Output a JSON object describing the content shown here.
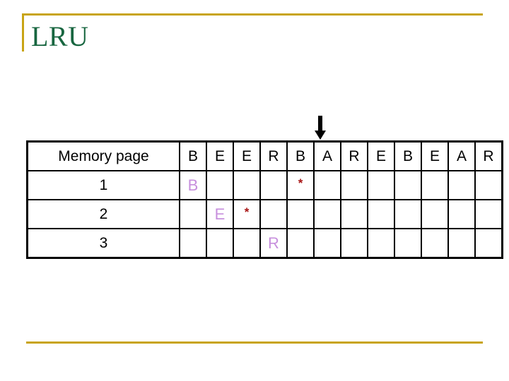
{
  "slide": {
    "title": "LRU",
    "accent_color": "#C8A415",
    "title_color": "#186640"
  },
  "pointer": {
    "icon": "down-arrow-icon",
    "points_at_column_index": 5,
    "points_at_label": "A"
  },
  "table": {
    "header": {
      "label": "Memory page",
      "sequence": [
        "B",
        "E",
        "E",
        "R",
        "B",
        "A",
        "R",
        "E",
        "B",
        "E",
        "A",
        "R"
      ]
    },
    "rows": [
      {
        "label": "1",
        "cells": [
          {
            "text": "B",
            "style": "page",
            "highlight": false
          },
          {
            "text": "",
            "style": "empty",
            "highlight": false
          },
          {
            "text": "",
            "style": "empty",
            "highlight": false
          },
          {
            "text": "",
            "style": "empty",
            "highlight": false
          },
          {
            "text": "*",
            "style": "star",
            "highlight": true
          },
          {
            "text": "",
            "style": "empty",
            "highlight": false
          },
          {
            "text": "",
            "style": "empty",
            "highlight": false
          },
          {
            "text": "",
            "style": "empty",
            "highlight": false
          },
          {
            "text": "",
            "style": "empty",
            "highlight": false
          },
          {
            "text": "",
            "style": "empty",
            "highlight": false
          },
          {
            "text": "",
            "style": "empty",
            "highlight": false
          },
          {
            "text": "",
            "style": "empty",
            "highlight": false
          }
        ]
      },
      {
        "label": "2",
        "cells": [
          {
            "text": "",
            "style": "empty",
            "highlight": false
          },
          {
            "text": "E",
            "style": "page",
            "highlight": false
          },
          {
            "text": "*",
            "style": "star",
            "highlight": true
          },
          {
            "text": "",
            "style": "empty",
            "highlight": true
          },
          {
            "text": "",
            "style": "empty",
            "highlight": true
          },
          {
            "text": "",
            "style": "empty",
            "highlight": false
          },
          {
            "text": "",
            "style": "empty",
            "highlight": false
          },
          {
            "text": "",
            "style": "empty",
            "highlight": false
          },
          {
            "text": "",
            "style": "empty",
            "highlight": false
          },
          {
            "text": "",
            "style": "empty",
            "highlight": false
          },
          {
            "text": "",
            "style": "empty",
            "highlight": false
          },
          {
            "text": "",
            "style": "empty",
            "highlight": false
          }
        ]
      },
      {
        "label": "3",
        "cells": [
          {
            "text": "",
            "style": "empty",
            "highlight": false
          },
          {
            "text": "",
            "style": "empty",
            "highlight": false
          },
          {
            "text": "",
            "style": "empty",
            "highlight": false
          },
          {
            "text": "R",
            "style": "page",
            "highlight": true
          },
          {
            "text": "",
            "style": "empty",
            "highlight": true
          },
          {
            "text": "",
            "style": "empty",
            "highlight": false
          },
          {
            "text": "",
            "style": "empty",
            "highlight": false
          },
          {
            "text": "",
            "style": "empty",
            "highlight": false
          },
          {
            "text": "",
            "style": "empty",
            "highlight": false
          },
          {
            "text": "",
            "style": "empty",
            "highlight": false
          },
          {
            "text": "",
            "style": "empty",
            "highlight": false
          },
          {
            "text": "",
            "style": "empty",
            "highlight": false
          }
        ]
      }
    ],
    "colors": {
      "highlight": "#FFFB5E",
      "page_letter": "#C78FDD",
      "star": "#A81414",
      "grid": "#000000"
    }
  }
}
